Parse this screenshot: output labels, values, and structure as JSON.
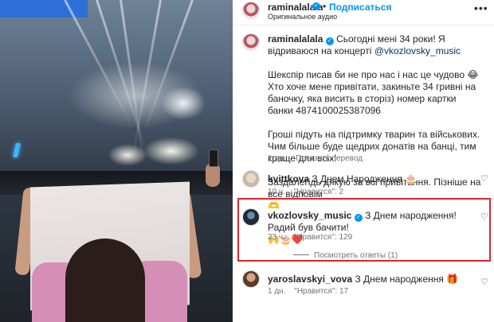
{
  "header": {
    "username": "raminalalala",
    "follow_label": "Подписаться",
    "audio_label": "Оригинальное аудио",
    "more_icon": "more-horizontal-icon"
  },
  "caption": {
    "username": "raminalalala",
    "line1": "Сьогодні мені 34 роки! Я відриваюся на концерті",
    "mention": "@vkozlovsky_music",
    "para2": "Шекспір писав би не про нас і нас це чудово 😂\nХто хоче мене привітати, закиньте 34 гривні на баночку, яка висить в сторіз) номер картки банки 4874100025387096",
    "para3": "Гроші підуть на підтримку тварин та військових. Чим більше буде щедрих донатів на банці, тим краще для всіх!",
    "para4": "Заздалегідь дякую за всі привітання. Пізніше на все відповім\n🫶",
    "time": "1 дн.",
    "translate_label": "Показать перевод"
  },
  "comments": [
    {
      "username": "kvittkova",
      "text": "З Днем Народження 🎂",
      "time": "10 ч.",
      "likes_label": "\"Нравится\": 2"
    },
    {
      "username": "vkozlovsky_music",
      "text": "З Днем народження! Радий був бачити!",
      "emojis": "🙌🎂❤️",
      "time": "23 ч.",
      "likes_label": "\"Нравится\": 129",
      "replies_label": "Посмотреть ответы (1)"
    },
    {
      "username": "yaroslavskyi_vova",
      "text": "З Днем народження 🎁",
      "time": "1 дн.",
      "likes_label": "\"Нравится\": 17"
    }
  ],
  "colors": {
    "accent": "#0095f6",
    "highlight": "#e0242d",
    "muted": "#737373"
  }
}
